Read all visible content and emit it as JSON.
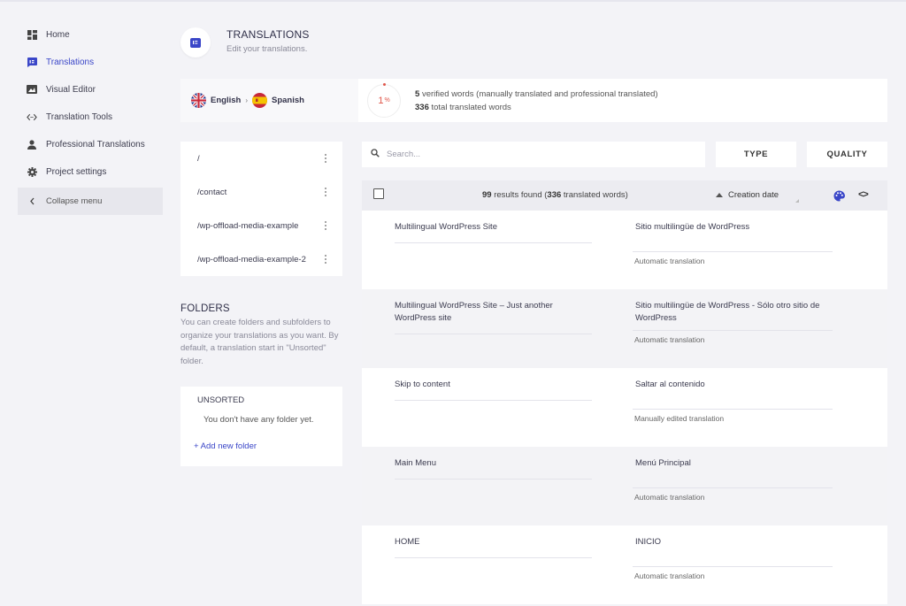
{
  "sidebar": {
    "items": [
      {
        "label": "Home",
        "icon": "dashboard-icon"
      },
      {
        "label": "Translations",
        "icon": "translate-icon"
      },
      {
        "label": "Visual Editor",
        "icon": "edit-image-icon"
      },
      {
        "label": "Translation Tools",
        "icon": "code-icon"
      },
      {
        "label": "Professional Translations",
        "icon": "person-icon"
      },
      {
        "label": "Project settings",
        "icon": "gear-icon"
      }
    ],
    "collapse_label": "Collapse menu"
  },
  "header": {
    "title": "TRANSLATIONS",
    "subtitle": "Edit your translations."
  },
  "languages": {
    "source": "English",
    "target": "Spanish"
  },
  "stats": {
    "percent": "1",
    "percent_unit": "%",
    "verified_count": "5",
    "verified_text": "verified words (manually translated and professional translated)",
    "total_count": "336",
    "total_text": "total translated words"
  },
  "urls": [
    "/",
    "/contact",
    "/wp-offload-media-example",
    "/wp-offload-media-example-2"
  ],
  "folders": {
    "title": "FOLDERS",
    "description": "You can create folders and subfolders to organize your translations as you want. By default, a translation start in \"Unsorted\" folder.",
    "unsorted_label": "UNSORTED",
    "empty_text": "You don't have any folder yet.",
    "add_label": "+ Add new folder"
  },
  "search": {
    "placeholder": "Search..."
  },
  "filters": {
    "type_label": "TYPE",
    "quality_label": "QUALITY"
  },
  "results": {
    "count": "99",
    "count_text": "results found (",
    "words": "336",
    "words_text": "translated words)",
    "sort_label": "Creation date"
  },
  "rows": [
    {
      "source": "Multilingual WordPress Site",
      "target": "Sitio multilingüe de WordPress",
      "status": "Automatic translation"
    },
    {
      "source": "Multilingual WordPress Site – Just another WordPress site",
      "target": "Sitio multilingüe de WordPress - Sólo otro sitio de WordPress",
      "status": "Automatic translation"
    },
    {
      "source": "Skip to content",
      "target": "Saltar al contenido",
      "status": "Manually edited translation"
    },
    {
      "source": "Main Menu",
      "target": "Menú Principal",
      "status": "Automatic translation"
    },
    {
      "source": "HOME",
      "target": "INICIO",
      "status": "Automatic translation"
    }
  ],
  "colors": {
    "accent": "#3a46c8",
    "percent_red": "#e0564a",
    "background": "#f3f3f7"
  }
}
